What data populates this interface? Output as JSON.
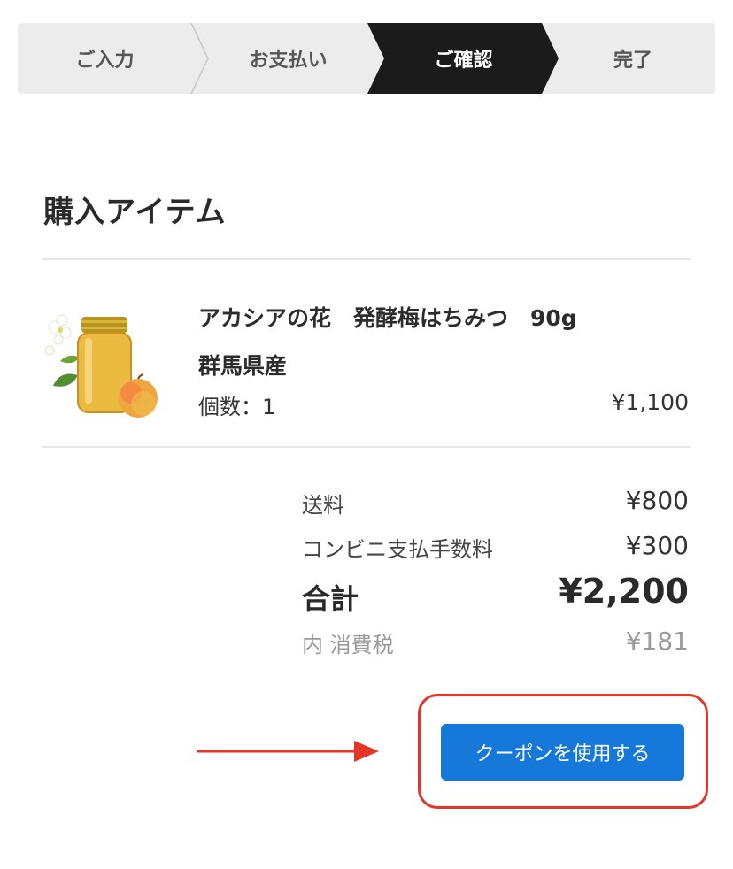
{
  "steps": [
    {
      "label": "ご入力"
    },
    {
      "label": "お支払い"
    },
    {
      "label": "ご確認"
    },
    {
      "label": "完了"
    }
  ],
  "active_step_index": 2,
  "colors": {
    "step_active_bg": "#1b1b1b",
    "step_bg": "#ececec",
    "primary_button": "#1678d9",
    "highlight_border": "#e5352a"
  },
  "section_title": "購入アイテム",
  "item": {
    "name_line1": "アカシアの花　発酵梅はちみつ　90g",
    "name_line2": "群馬県産",
    "quantity": "個数：1",
    "price": "¥1,100",
    "image_icon": "honey-jar-icon"
  },
  "summary": {
    "shipping_label": "送料",
    "shipping_value": "¥800",
    "fee_label": "コンビニ支払手数料",
    "fee_value": "¥300",
    "total_label": "合計",
    "total_value": "¥2,200",
    "tax_label": "内 消費税",
    "tax_value": "¥181"
  },
  "coupon_button": "クーポンを使用する"
}
